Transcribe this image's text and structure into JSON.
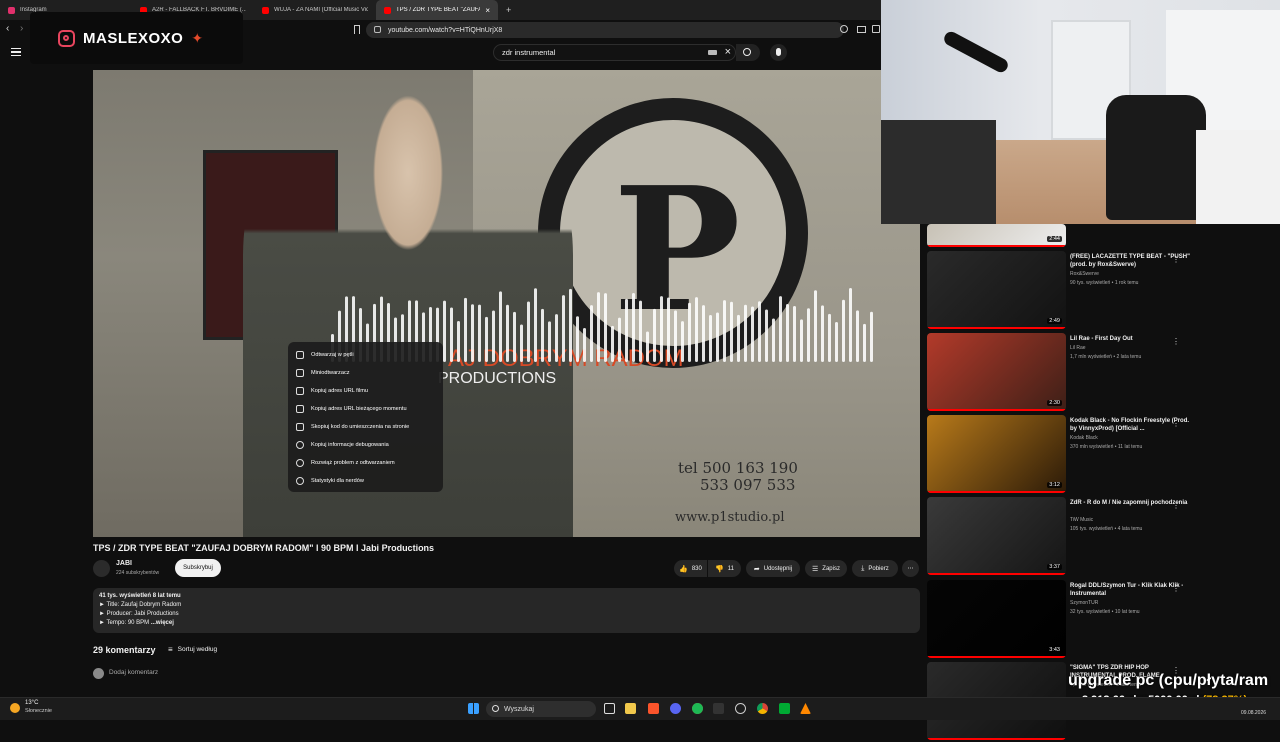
{
  "browser": {
    "tabs": [
      {
        "label": "Instagram",
        "color": "#e1306c"
      },
      {
        "label": "A2R - FALLBACK FT. BRVDIME (...",
        "color": "#ff0000"
      },
      {
        "label": "WUJA - ZA NAMI (Official Music Vide...",
        "color": "#ff0000"
      },
      {
        "label": "TPS / ZDR TYPE BEAT \"ZAUFAJ D...",
        "color": "#ff0000",
        "active": true
      }
    ],
    "new_tab": "+",
    "url": "youtube.com/watch?v=HTiQHnUrjX8"
  },
  "overlay": {
    "username": "MASLEXOXO"
  },
  "youtube": {
    "search_value": "zdr instrumental",
    "video": {
      "title_red": "AJ DOBRYM RADOM",
      "title_white": "PRODUCTIONS",
      "phone": [
        "tel 500 163 190",
        "533 097 533"
      ],
      "website": "www.p1studio.pl"
    },
    "context_menu": [
      {
        "label": "Odtwarzaj w pętli",
        "icon": "loop-icon"
      },
      {
        "label": "Miniodtwarzacz",
        "icon": "miniplayer-icon"
      },
      {
        "label": "Kopiuj adres URL filmu",
        "icon": "link-icon"
      },
      {
        "label": "Kopiuj adres URL bieżącego momentu",
        "icon": "link-icon"
      },
      {
        "label": "Skopiuj kod do umieszczenia na stronie",
        "icon": "embed-icon"
      },
      {
        "label": "Kopiuj informacje debugowania",
        "icon": "debug-icon"
      },
      {
        "label": "Rozwiąż problem z odtwarzaniem",
        "icon": "help-icon"
      },
      {
        "label": "Statystyki dla nerdów",
        "icon": "info-icon"
      }
    ],
    "title": "TPS / ZDR TYPE BEAT \"ZAUFAJ DOBRYM RADOM\" l 90 BPM l Jabi Productions",
    "channel": {
      "name": "JABI",
      "subscribers": "224 subskrybentów",
      "subscribe": "Subskrybuj"
    },
    "actions": {
      "likes": "830",
      "dislikes": "11",
      "share": "Udostępnij",
      "save": "Zapisz",
      "download": "Pobierz",
      "more": "⋯"
    },
    "description": {
      "stats": "41 tys. wyświetleń  8 lat temu",
      "lines": [
        "► Title: Zaufaj Dobrym Radom",
        "► Producer: Jabi Productions",
        "► Tempo: 90 BPM"
      ],
      "more": "...więcej"
    },
    "comments": {
      "count": "29 komentarzy",
      "sort": "Sortuj według",
      "add": "Dodaj komentarz"
    },
    "recommendations": [
      {
        "title": "",
        "channel": "",
        "meta": "",
        "duration": "2:44",
        "colors": [
          "#c7c1b5",
          "#eee"
        ]
      },
      {
        "title": "(FREE) LACAZETTE TYPE BEAT - \"PUSH\" (prod. by Rox&Swerve)",
        "channel": "Rox&Swerve",
        "meta": "90 tys. wyświetleń • 1 rok temu",
        "duration": "2:49",
        "colors": [
          "#2a2a2a",
          "#121212"
        ]
      },
      {
        "title": "Lil Rae - First Day Out",
        "channel": "Lil Rae",
        "meta": "1,7 mln wyświetleń • 2 lata temu",
        "duration": "2:30",
        "colors": [
          "#b33a2a",
          "#3d1f17"
        ]
      },
      {
        "title": "Kodak Black - No Flockin Freestyle (Prod. by VinnyxProd) [Official ...",
        "channel": "Kodak Black",
        "meta": "370 mln wyświetleń • 11 lat temu",
        "duration": "3:12",
        "colors": [
          "#b87a1a",
          "#2b1a08"
        ]
      },
      {
        "title": "ZdR - R do M / Nie zapomnij pochodzenia",
        "channel": "TiW Music",
        "meta": "105 tys. wyświetleń • 4 lata temu",
        "duration": "3:37",
        "colors": [
          "#3a3a3a",
          "#151515"
        ]
      },
      {
        "title": "Rogal DDL/Szymon Tur - Klik Klak Klik - Instrumental",
        "channel": "SzymonTUR",
        "meta": "32 tys. wyświetleń • 10 lat temu",
        "duration": "3:43",
        "colors": [
          "#050505",
          "#000"
        ]
      },
      {
        "title": "\"SIGMA\" TPS ZDR HIP HOP INSTRUMENTAL PROD. FLAME",
        "channel": "",
        "meta": "4,3 tys. wyświetleń • 3 lata temu",
        "duration": "",
        "colors": [
          "#2a2a2a",
          "#0f0f0f"
        ]
      }
    ]
  },
  "stream": {
    "goal_title": "upgrade pc (cpu/płyta/ram",
    "goal_current": "3 913,66 zł",
    "goal_sep": "z",
    "goal_target": "5000,00 zł",
    "goal_percent": "(78.27%)",
    "goal_fraction": 0.7827
  },
  "taskbar": {
    "temp": "13°C",
    "weather": "Słonecznie",
    "search": "Wyszukaj",
    "date": "09.08.2026"
  }
}
